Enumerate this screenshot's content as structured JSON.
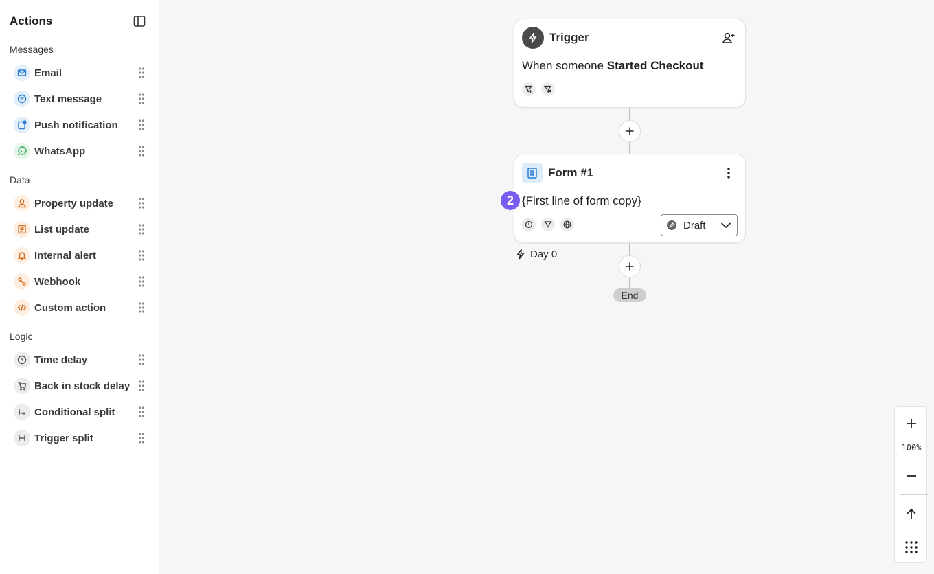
{
  "sidebar": {
    "title": "Actions",
    "sections": [
      {
        "label": "Messages",
        "items": [
          {
            "label": "Email",
            "icon": "envelope-icon"
          },
          {
            "label": "Text message",
            "icon": "chat-bubble-icon"
          },
          {
            "label": "Push notification",
            "icon": "push-notification-icon"
          },
          {
            "label": "WhatsApp",
            "icon": "whatsapp-icon"
          }
        ]
      },
      {
        "label": "Data",
        "items": [
          {
            "label": "Property update",
            "icon": "person-icon"
          },
          {
            "label": "List update",
            "icon": "list-icon"
          },
          {
            "label": "Internal alert",
            "icon": "bell-icon"
          },
          {
            "label": "Webhook",
            "icon": "webhook-icon"
          },
          {
            "label": "Custom action",
            "icon": "code-icon"
          }
        ]
      },
      {
        "label": "Logic",
        "items": [
          {
            "label": "Time delay",
            "icon": "clock-icon"
          },
          {
            "label": "Back in stock delay",
            "icon": "cart-icon"
          },
          {
            "label": "Conditional split",
            "icon": "split-icon"
          },
          {
            "label": "Trigger split",
            "icon": "trigger-split-icon"
          }
        ]
      }
    ]
  },
  "canvas": {
    "trigger": {
      "title": "Trigger",
      "description_prefix": "When someone ",
      "description_event": "Started Checkout"
    },
    "form": {
      "title": "Form #1",
      "step_number": "2",
      "copy": "{First line of form copy}",
      "status": "Draft"
    },
    "day_label": "Day 0",
    "end_label": "End"
  },
  "zoom": {
    "level": "100%"
  },
  "colors": {
    "step_badge": "#7a5cf0",
    "message_icon": "#2a7bd4",
    "whatsapp_icon": "#2aa24f",
    "data_icon": "#d06a1c"
  }
}
